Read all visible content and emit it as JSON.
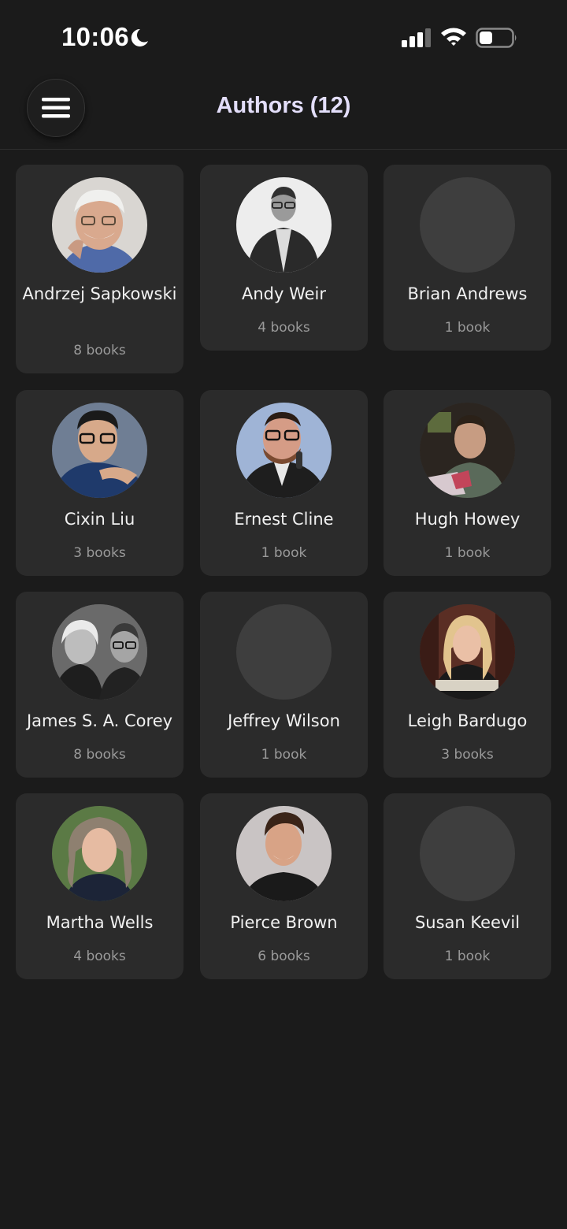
{
  "status_bar": {
    "time": "10:06",
    "icons": [
      "moon-icon",
      "cellular-signal-icon",
      "wifi-icon",
      "battery-icon"
    ]
  },
  "header": {
    "title": "Authors (12)",
    "menu_icon": "hamburger-menu-icon"
  },
  "colors": {
    "background": "#1b1b1b",
    "card": "#2b2b2b",
    "title": "#e3defa",
    "placeholder_avatar": "#3e3e3e",
    "secondary_text": "#9a9a9a"
  },
  "authors": [
    {
      "name": "Andrzej Sapkowski",
      "count": "8 books",
      "has_photo": true
    },
    {
      "name": "Andy Weir",
      "count": "4 books",
      "has_photo": true
    },
    {
      "name": "Brian Andrews",
      "count": "1 book",
      "has_photo": false
    },
    {
      "name": "Cixin Liu",
      "count": "3 books",
      "has_photo": true
    },
    {
      "name": "Ernest Cline",
      "count": "1 book",
      "has_photo": true
    },
    {
      "name": "Hugh Howey",
      "count": "1 book",
      "has_photo": true
    },
    {
      "name": "James S. A. Corey",
      "count": "8 books",
      "has_photo": true
    },
    {
      "name": "Jeffrey Wilson",
      "count": "1 book",
      "has_photo": false
    },
    {
      "name": "Leigh Bardugo",
      "count": "3 books",
      "has_photo": true
    },
    {
      "name": "Martha Wells",
      "count": "4 books",
      "has_photo": true
    },
    {
      "name": "Pierce Brown",
      "count": "6 books",
      "has_photo": true
    },
    {
      "name": "Susan Keevil",
      "count": "1 book",
      "has_photo": false
    }
  ]
}
